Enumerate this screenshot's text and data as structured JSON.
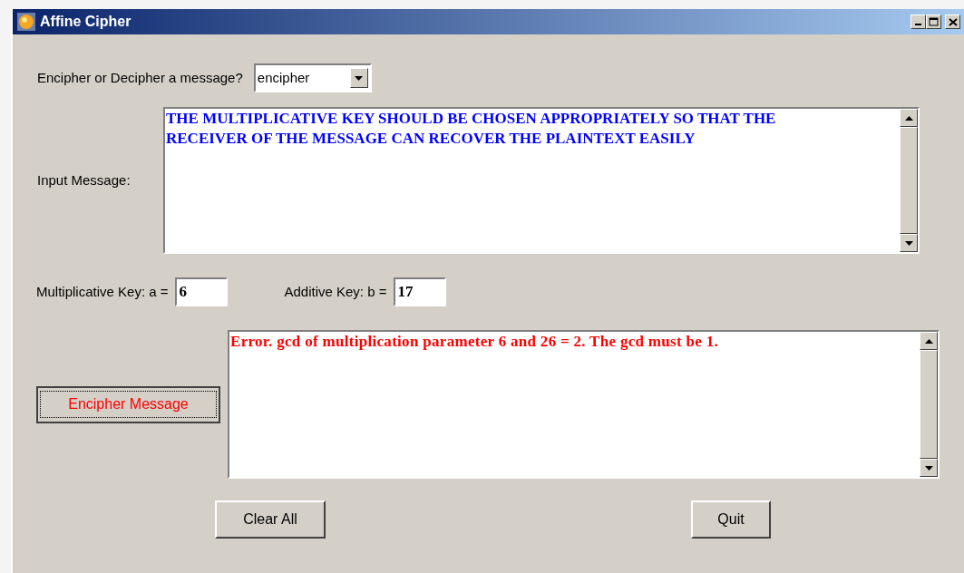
{
  "window": {
    "title": "Affine Cipher"
  },
  "mode": {
    "label": "Encipher or Decipher a message?",
    "value": "encipher"
  },
  "input": {
    "label": "Input Message:",
    "value": "THE MULTIPLICATIVE KEY SHOULD BE CHOSEN APPROPRIATELY SO THAT THE RECEIVER OF THE MESSAGE CAN RECOVER THE PLAINTEXT EASILY"
  },
  "keys": [
    {
      "label": "Multiplicative Key: a =",
      "value": "6"
    },
    {
      "label": "Additive Key: b =",
      "value": "17"
    }
  ],
  "action_button": {
    "label": "Encipher Message",
    "focused": true
  },
  "output": {
    "value": "Error. gcd of multiplication parameter 6 and 26 = 2. The gcd must be 1."
  },
  "buttons": [
    "Clear All",
    "Quit"
  ]
}
